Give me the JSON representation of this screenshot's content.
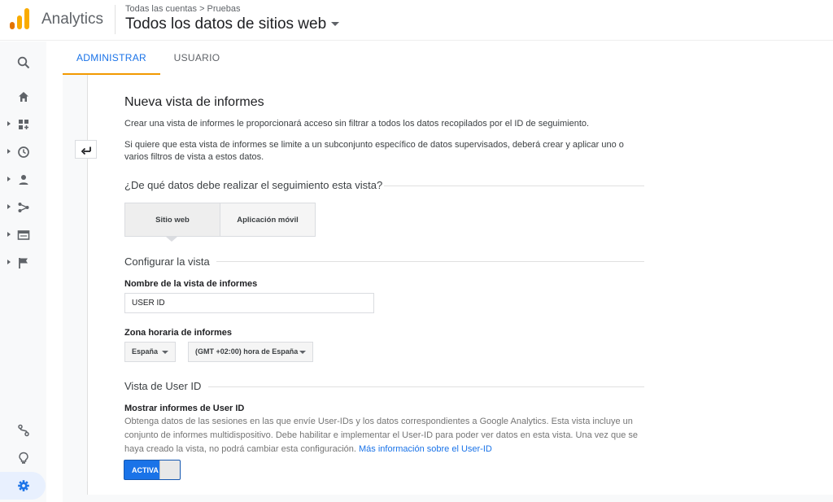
{
  "header": {
    "app_name": "Analytics",
    "breadcrumb": {
      "root": "Todas las cuentas",
      "separator": ">",
      "current": "Pruebas"
    },
    "property_name": "Todos los datos de sitios web"
  },
  "leftnav": {
    "items": [
      "search-icon",
      "home-icon",
      "customization-icon",
      "realtime-icon",
      "audience-icon",
      "acquisition-icon",
      "behavior-icon",
      "conversions-icon",
      "attribution-icon",
      "discover-icon",
      "admin-icon"
    ]
  },
  "tabs": [
    {
      "label": "ADMINISTRAR",
      "active": true
    },
    {
      "label": "USUARIO",
      "active": false
    }
  ],
  "form": {
    "title": "Nueva vista de informes",
    "intro1": "Crear una vista de informes le proporcionará acceso sin filtrar a todos los datos recopilados por el ID de seguimiento.",
    "intro2": "Si quiere que esta vista de informes se limite a un subconjunto específico de datos supervisados, deberá crear y aplicar uno o varios filtros de vista a estos datos.",
    "tracking_question": "¿De qué datos debe realizar el seguimiento esta vista?",
    "options": [
      {
        "label": "Sitio web",
        "selected": true
      },
      {
        "label": "Aplicación móvil",
        "selected": false
      }
    ],
    "configure_section": "Configurar la vista",
    "view_name_label": "Nombre de la vista de informes",
    "view_name_value": "USER ID",
    "timezone_label": "Zona horaria de informes",
    "country_value": "España",
    "timezone_value": "(GMT +02:00) hora de España",
    "userid_section": "Vista de User ID",
    "userid_label": "Mostrar informes de User ID",
    "userid_help": "Obtenga datos de las sesiones en las que envíe User-IDs y los datos correspondientes a Google Analytics. Esta vista incluye un conjunto de informes multidispositivo. Debe habilitar e implementar el User-ID para poder ver datos en esta vista. Una vez que se haya creado la vista, no podrá cambiar esta configuración.",
    "userid_link": "Más información sobre el User-ID",
    "toggle_label": "ACTIVA",
    "toggle_on": true
  },
  "colors": {
    "accent": "#1a73e8",
    "tab_underline": "#f29900",
    "logo_orange": "#e37400",
    "logo_yellow": "#f9ab00"
  }
}
